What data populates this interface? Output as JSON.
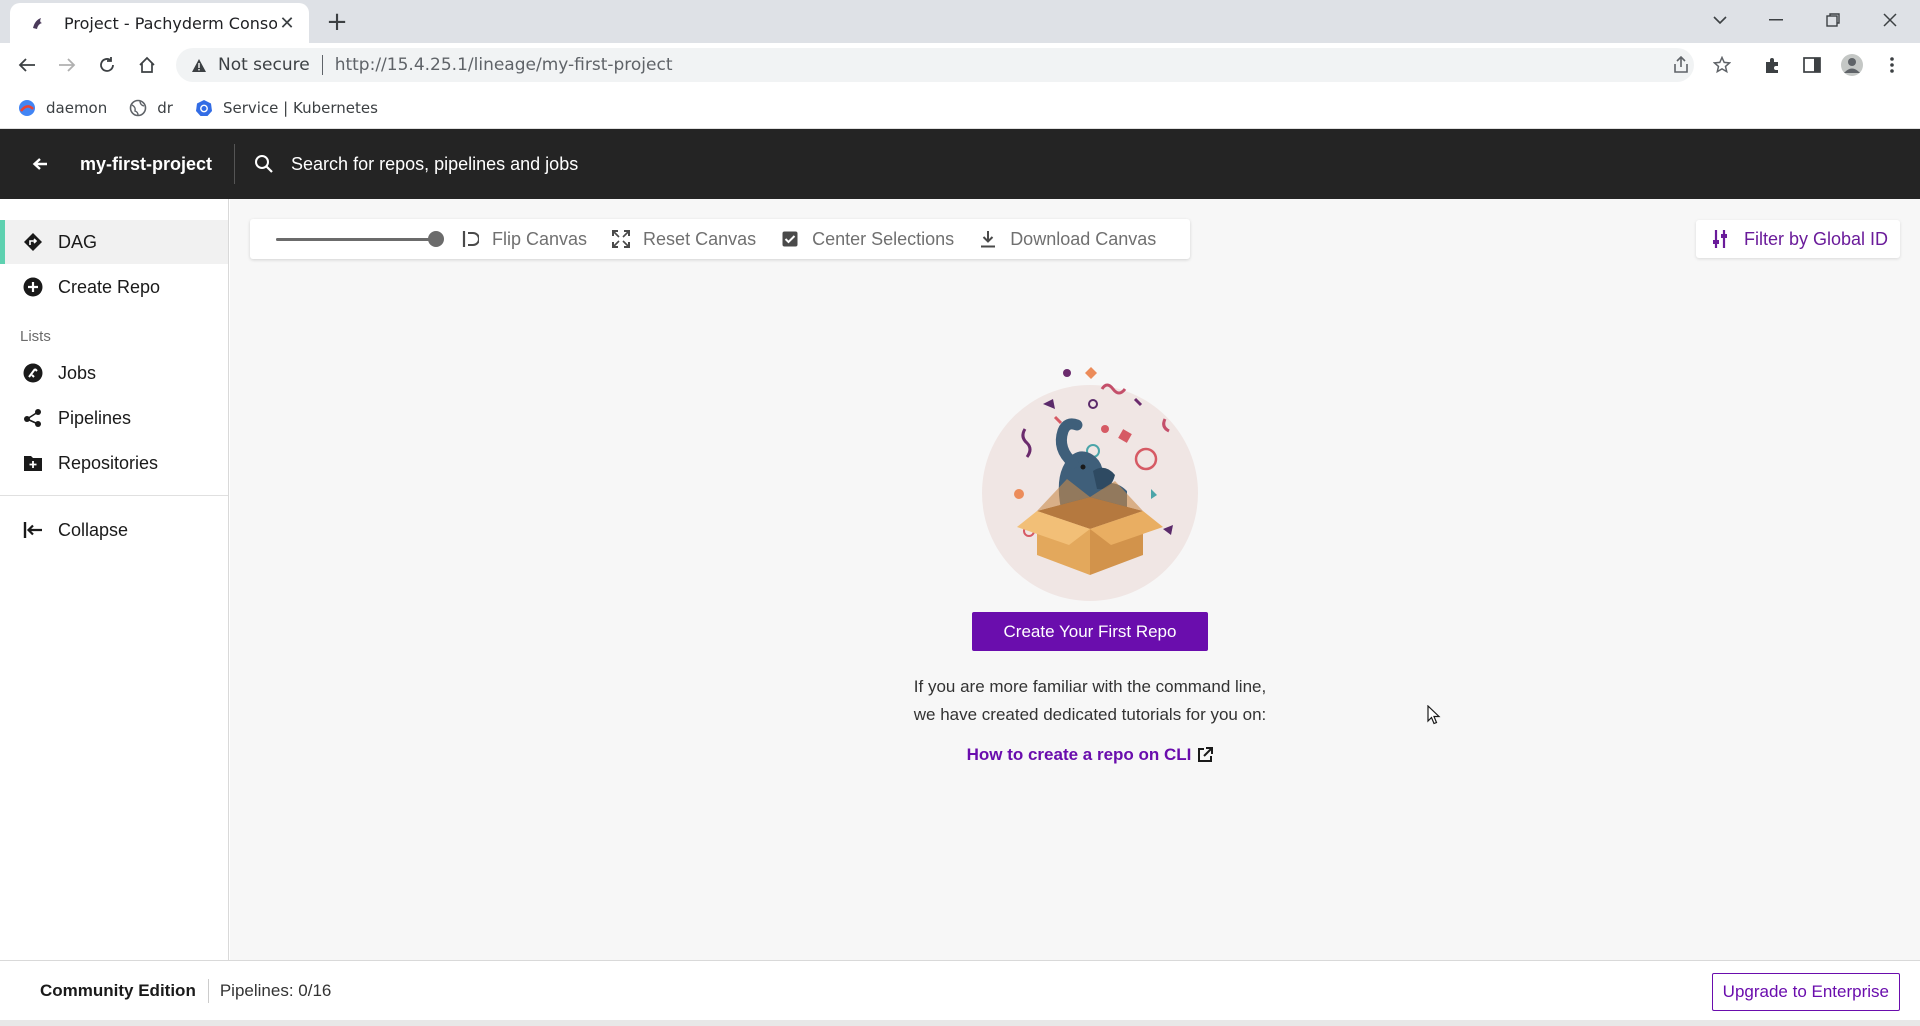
{
  "browser": {
    "tab_title": "Project - Pachyderm Console",
    "omnibox": {
      "security_label": "Not secure",
      "url": "http://15.4.25.1/lineage/my-first-project"
    },
    "bookmarks": [
      {
        "label": "daemon",
        "icon": "daemon-icon"
      },
      {
        "label": "dr",
        "icon": "globe-icon"
      },
      {
        "label": "Service | Kubernetes",
        "icon": "kubernetes-icon"
      }
    ]
  },
  "header": {
    "project_name": "my-first-project",
    "search_placeholder": "Search for repos, pipelines and jobs"
  },
  "sidebar": {
    "items": [
      {
        "label": "DAG",
        "icon": "dag-icon",
        "active": true
      },
      {
        "label": "Create Repo",
        "icon": "plus-circle-icon"
      }
    ],
    "lists_heading": "Lists",
    "list_items": [
      {
        "label": "Jobs",
        "icon": "jobs-icon"
      },
      {
        "label": "Pipelines",
        "icon": "pipelines-icon"
      },
      {
        "label": "Repositories",
        "icon": "folder-add-icon"
      }
    ],
    "collapse_label": "Collapse"
  },
  "canvas_tools": {
    "zoom_level": 1.0,
    "flip": "Flip Canvas",
    "reset": "Reset Canvas",
    "center": "Center Selections",
    "center_checked": true,
    "download": "Download Canvas"
  },
  "filter": {
    "label": "Filter by Global ID"
  },
  "empty_state": {
    "cta_label": "Create Your First Repo",
    "help_line1": "If you are more familiar with the command line,",
    "help_line2": "we have created dedicated tutorials for you on:",
    "link_label": "How to create a repo on CLI"
  },
  "footer": {
    "edition": "Community Edition",
    "pipelines": "Pipelines: 0/16",
    "upgrade_label": "Upgrade to Enterprise"
  },
  "colors": {
    "brand_purple": "#6a0dad",
    "active_accent": "#5ed1b0",
    "appbar_bg": "#242424"
  }
}
